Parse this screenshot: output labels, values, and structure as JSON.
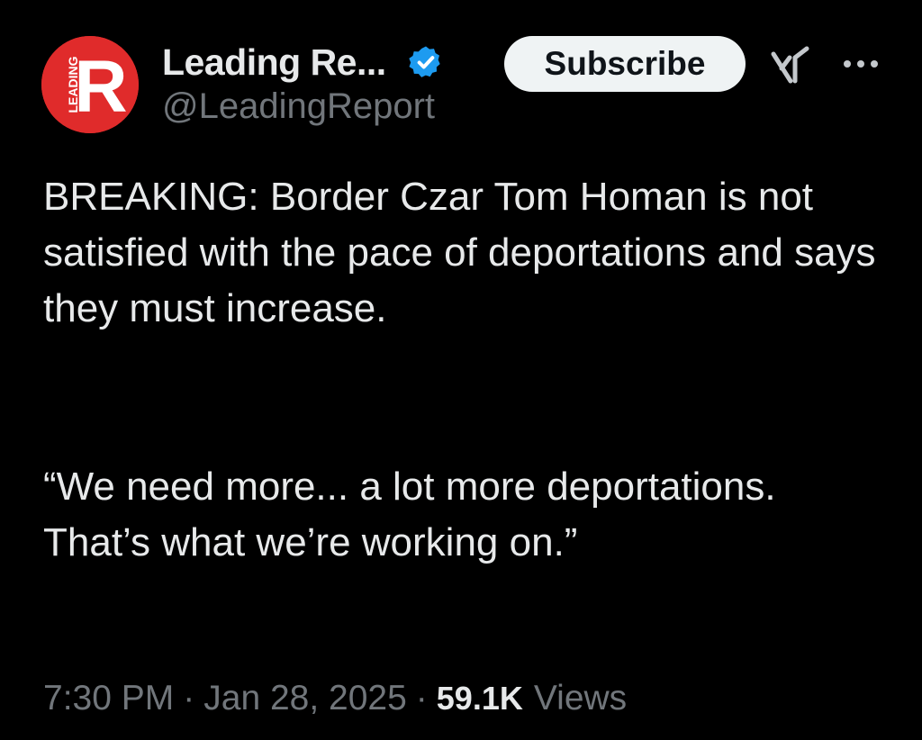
{
  "author": {
    "display_name": "Leading Re...",
    "handle": "@LeadingReport",
    "verified": true,
    "avatar": {
      "letter": "R",
      "side_text": "LEADING",
      "background": "#e02b2b",
      "foreground": "#ffffff"
    }
  },
  "actions": {
    "subscribe_label": "Subscribe",
    "grok_icon": "grok-icon",
    "more_icon": "more-options-icon"
  },
  "tweet": {
    "text": "BREAKING: Border Czar Tom Homan is not satisfied with the pace of deportations and says they must increase.",
    "quote": "“We need more... a lot more deportations. That’s what we’re working on.”"
  },
  "meta": {
    "time": "7:30 PM",
    "separator": "·",
    "date": "Jan 28, 2025",
    "views_count": "59.1K",
    "views_label": "Views"
  },
  "colors": {
    "background": "#000000",
    "text_primary": "#e7e9ea",
    "text_secondary": "#71767b",
    "verified_badge": "#1d9bf0",
    "subscribe_bg": "#eff3f4"
  }
}
